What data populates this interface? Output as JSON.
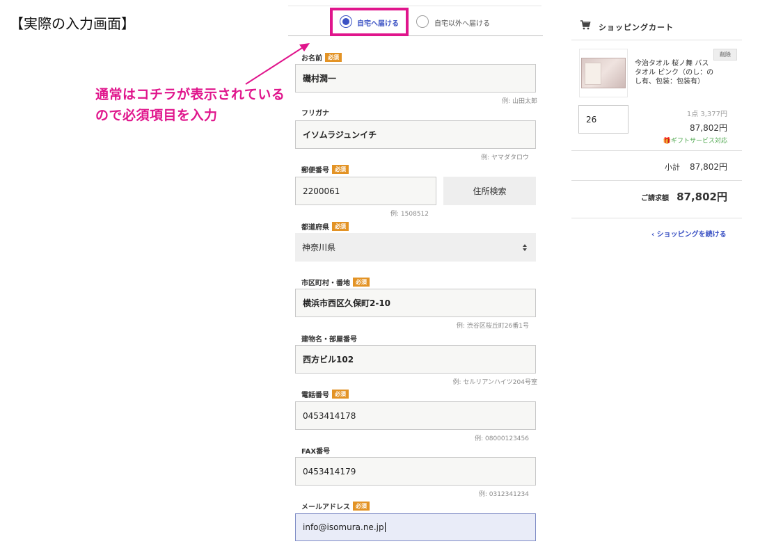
{
  "caption": "【実際の入力画面】",
  "annotation": {
    "line1": "通常はコチラが表示されている",
    "line2": "ので必須項目を入力",
    "color": "#e0158c"
  },
  "delivery_tabs": [
    {
      "label": "自宅へ届ける",
      "selected": true
    },
    {
      "label": "自宅以外へ届ける",
      "selected": false
    }
  ],
  "required_badge": "必須",
  "form": {
    "name": {
      "label": "お名前",
      "value": "磯村潤一",
      "hint": "例: 山田太郎"
    },
    "kana": {
      "label": "フリガナ",
      "value": "イソムラジュンイチ",
      "hint": "例: ヤマダタロウ"
    },
    "postal": {
      "label": "郵便番号",
      "value": "2200061",
      "hint": "例: 1508512",
      "search_button": "住所検索"
    },
    "prefecture": {
      "label": "都道府県",
      "value": "神奈川県"
    },
    "city": {
      "label": "市区町村・番地",
      "value": "横浜市西区久保町2-10",
      "hint": "例: 渋谷区桜丘町26番1号"
    },
    "building": {
      "label": "建物名・部屋番号",
      "value": "西方ビル102",
      "hint": "例: セルリアンハイツ204号室"
    },
    "phone": {
      "label": "電話番号",
      "value": "0453414178",
      "hint": "例: 08000123456"
    },
    "fax": {
      "label": "FAX番号",
      "value": "0453414179",
      "hint": "例: 0312341234"
    },
    "email": {
      "label": "メールアドレス",
      "value": "info@isomura.ne.jp"
    }
  },
  "cart": {
    "title": "ショッピングカート",
    "item": {
      "name": "今治タオル 桜ノ舞 バスタオル ピンク（のし：のし有、包装：包装有）",
      "delete": "削除",
      "quantity": "26",
      "unit_price": "1点 3,377円",
      "line_total": "87,802円",
      "gift": "ギフトサービス対応"
    },
    "subtotal_label": "小計",
    "subtotal": "87,802円",
    "total_label": "ご請求額",
    "total": "87,802円",
    "continue": "ショッピングを続ける"
  },
  "icons": {
    "cart": "cart-icon",
    "select": "select-arrows-icon",
    "gift": "gift-icon",
    "back": "chevron-left-icon"
  }
}
